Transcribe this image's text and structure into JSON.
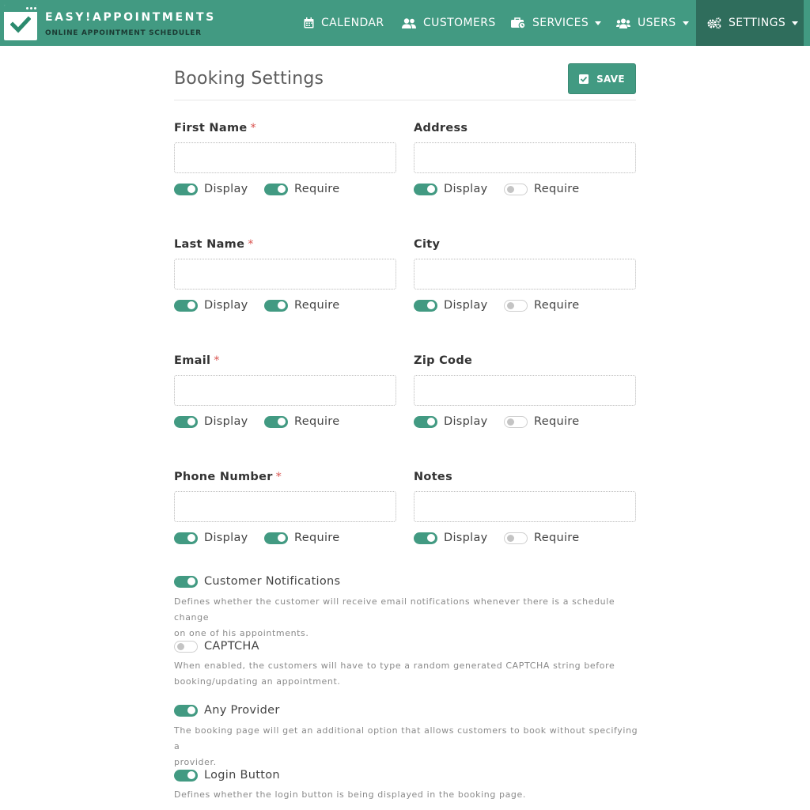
{
  "header": {
    "brand_title": "EASY!APPOINTMENTS",
    "brand_subtitle": "ONLINE APPOINTMENT SCHEDULER",
    "nav": [
      {
        "label": "CALENDAR",
        "icon": "calendar-icon"
      },
      {
        "label": "CUSTOMERS",
        "icon": "users-icon"
      },
      {
        "label": "SERVICES",
        "icon": "briefcase-icon"
      },
      {
        "label": "USERS",
        "icon": "users-group-icon"
      },
      {
        "label": "SETTINGS",
        "icon": "cogs-icon"
      }
    ]
  },
  "page": {
    "title": "Booking Settings",
    "save_label": "SAVE"
  },
  "toggle_labels": {
    "display": "Display",
    "require": "Require"
  },
  "fields": [
    {
      "label": "First Name",
      "required_mark": "*",
      "display": true,
      "require": true
    },
    {
      "label": "Address",
      "required_mark": "",
      "display": true,
      "require": false
    },
    {
      "label": "Last Name",
      "required_mark": "*",
      "display": true,
      "require": true
    },
    {
      "label": "City",
      "required_mark": "",
      "display": true,
      "require": false
    },
    {
      "label": "Email",
      "required_mark": "*",
      "display": true,
      "require": true
    },
    {
      "label": "Zip Code",
      "required_mark": "",
      "display": true,
      "require": false
    },
    {
      "label": "Phone Number",
      "required_mark": "*",
      "display": true,
      "require": true
    },
    {
      "label": "Notes",
      "required_mark": "",
      "display": true,
      "require": false
    }
  ],
  "options": [
    {
      "label": "Customer Notifications",
      "enabled": true,
      "desc_line1": "Defines whether the customer will receive email notifications whenever there is a schedule change",
      "desc_line2": "on one of his appointments."
    },
    {
      "label": "CAPTCHA",
      "enabled": false,
      "desc_line1": "When enabled, the customers will have to type a random generated CAPTCHA string before",
      "desc_line2": "booking/updating an appointment."
    },
    {
      "label": "Any Provider",
      "enabled": true,
      "desc_line1": "The booking page will get an additional option that allows customers to book without specifying a",
      "desc_line2": "provider."
    },
    {
      "label": "Login Button",
      "enabled": true,
      "desc_line1": "Defines whether the login button is being displayed in the booking page.",
      "desc_line2": ""
    }
  ],
  "colors": {
    "accent": "#429a82",
    "accent_dark": "#2f6d5c",
    "required": "#d9534f"
  }
}
